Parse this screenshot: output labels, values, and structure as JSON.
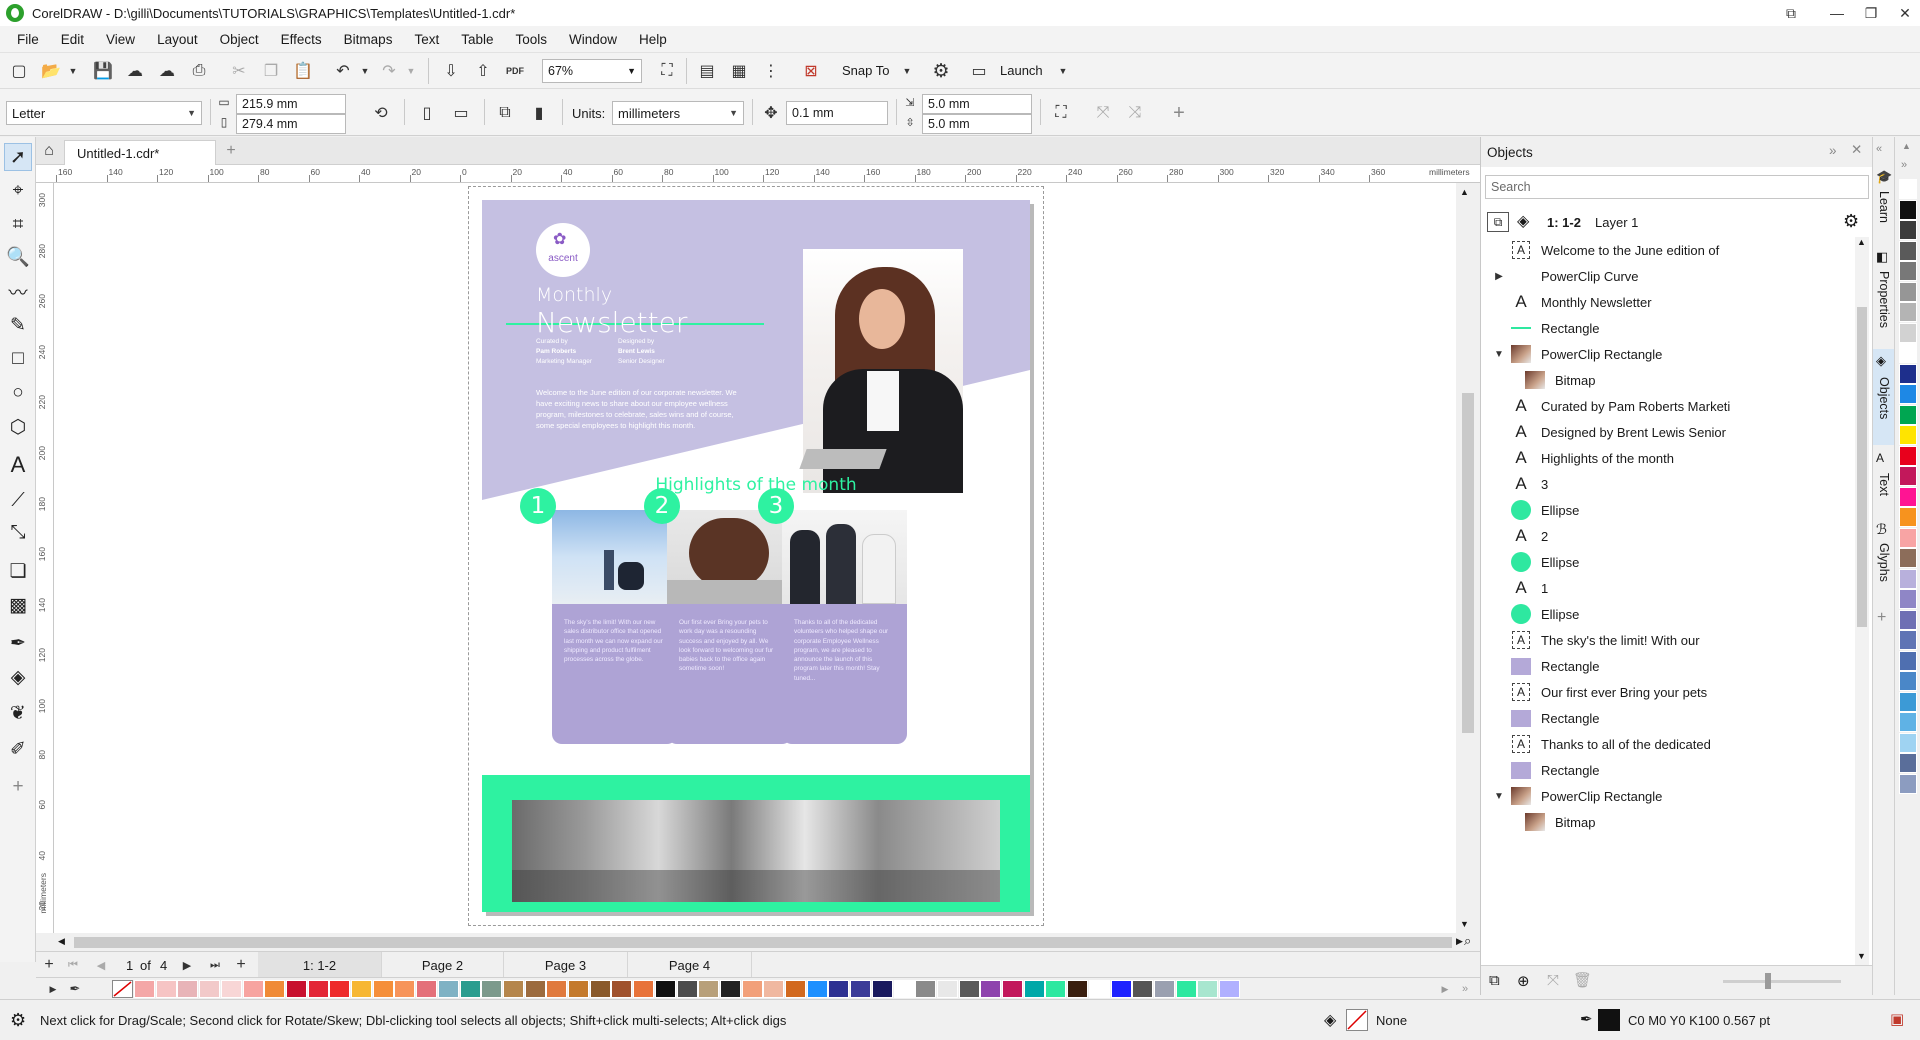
{
  "window": {
    "title": "CorelDRAW - D:\\gilli\\Documents\\TUTORIALS\\GRAPHICS\\Templates\\Untitled-1.cdr*"
  },
  "menu": [
    "File",
    "Edit",
    "View",
    "Layout",
    "Object",
    "Effects",
    "Bitmaps",
    "Text",
    "Table",
    "Tools",
    "Window",
    "Help"
  ],
  "standard_toolbar": {
    "zoom": "67%",
    "snap_to": "Snap To",
    "launch": "Launch",
    "pdf_label": "PDF"
  },
  "property_bar": {
    "page_size": "Letter",
    "width": "215.9 mm",
    "height": "279.4 mm",
    "units_label": "Units:",
    "units": "millimeters",
    "nudge": "0.1 mm",
    "dup_x": "5.0 mm",
    "dup_y": "5.0 mm"
  },
  "doc_tab": "Untitled-1.cdr*",
  "rulers": {
    "unit": "millimeters",
    "h_ticks": [
      "160",
      "140",
      "120",
      "100",
      "80",
      "60",
      "40",
      "20",
      "0",
      "20",
      "40",
      "60",
      "80",
      "100",
      "120",
      "140",
      "160",
      "180",
      "200",
      "220",
      "240",
      "260",
      "280",
      "300",
      "320",
      "340",
      "360"
    ],
    "v_ticks": [
      "300",
      "280",
      "260",
      "240",
      "220",
      "200",
      "180",
      "160",
      "140",
      "120",
      "100",
      "80",
      "60",
      "40",
      "20"
    ]
  },
  "newsletter": {
    "logo": "ascent",
    "monthly": "Monthly",
    "newsletter": "Newsletter",
    "curated_by_label": "Curated by",
    "curated_name": "Pam Roberts",
    "curated_role": "Marketing Manager",
    "designed_by_label": "Designed by",
    "designed_name": "Brent Lewis",
    "designed_role": "Senior Designer",
    "intro": "Welcome to the June edition of our corporate newsletter. We have exciting news to share about our employee wellness program, milestones to celebrate, sales wins and of course, some special employees to highlight this month.",
    "highlights": "Highlights of the month",
    "cards": [
      {
        "num": "1",
        "text": "The sky's the limit! With our new sales distributor office that opened last month we can now expand our shipping and product fulfilment processes across the globe."
      },
      {
        "num": "2",
        "text": "Our first ever Bring your pets to work day was a resounding success and enjoyed by all. We look forward to welcoming our fur babies back to the office again sometime soon!"
      },
      {
        "num": "3",
        "text": "Thanks to all of the dedicated volunteers who helped shape our corporate Employee Wellness program, we are pleased to announce the launch of this program later this month! Stay tuned..."
      }
    ]
  },
  "page_nav": {
    "current": "1",
    "of_label": "of",
    "total": "4",
    "tabs": [
      "1: 1-2",
      "Page 2",
      "Page 3",
      "Page 4"
    ]
  },
  "docker": {
    "title": "Objects",
    "search_placeholder": "Search",
    "page_label": "1: 1-2",
    "layer_label": "Layer 1",
    "items": [
      {
        "expander": "",
        "icon": "para",
        "label": "Welcome to the June edition of"
      },
      {
        "expander": "▶",
        "icon": "none",
        "label": "PowerClip Curve"
      },
      {
        "expander": "",
        "icon": "text",
        "label": "Monthly Newsletter"
      },
      {
        "expander": "",
        "icon": "line",
        "label": "Rectangle"
      },
      {
        "expander": "▼",
        "icon": "photo",
        "label": "PowerClip Rectangle"
      },
      {
        "expander": "",
        "icon": "photo",
        "label": "Bitmap",
        "indent": true
      },
      {
        "expander": "",
        "icon": "text",
        "label": "Curated by Pam Roberts Marketi"
      },
      {
        "expander": "",
        "icon": "text",
        "label": "Designed by Brent Lewis Senior"
      },
      {
        "expander": "",
        "icon": "text",
        "label": "Highlights of the month"
      },
      {
        "expander": "",
        "icon": "text",
        "label": "3"
      },
      {
        "expander": "",
        "icon": "ellipse",
        "label": "Ellipse"
      },
      {
        "expander": "",
        "icon": "text",
        "label": "2"
      },
      {
        "expander": "",
        "icon": "ellipse",
        "label": "Ellipse"
      },
      {
        "expander": "",
        "icon": "text",
        "label": "1"
      },
      {
        "expander": "",
        "icon": "ellipse",
        "label": "Ellipse"
      },
      {
        "expander": "",
        "icon": "para",
        "label": "The sky's the limit! With our"
      },
      {
        "expander": "",
        "icon": "rect",
        "label": "Rectangle"
      },
      {
        "expander": "",
        "icon": "para",
        "label": "Our first ever Bring your pets"
      },
      {
        "expander": "",
        "icon": "rect",
        "label": "Rectangle"
      },
      {
        "expander": "",
        "icon": "para",
        "label": "Thanks to all of the dedicated"
      },
      {
        "expander": "",
        "icon": "rect",
        "label": "Rectangle"
      },
      {
        "expander": "▼",
        "icon": "photo",
        "label": "PowerClip Rectangle"
      },
      {
        "expander": "",
        "icon": "photo",
        "label": "Bitmap",
        "indent": true
      }
    ]
  },
  "side_tabs": [
    "Learn",
    "Properties",
    "Objects",
    "Text",
    "Glyphs"
  ],
  "status": {
    "hint": "Next click for Drag/Scale; Second click for Rotate/Skew; Dbl-clicking tool selects all objects; Shift+click multi-selects; Alt+click digs",
    "fill": "None",
    "outline": "C0 M0 Y0 K100  0.567 pt"
  },
  "colors": {
    "accent_green": "#2ef2a1",
    "lavender": "#c5c0e2",
    "card_purple": "#aea3d5"
  },
  "palette_bottom": [
    "#f4a7a7",
    "#f6c4c4",
    "#e8b4b8",
    "#f2c9c9",
    "#f8d6d6",
    "#f7a4a0",
    "#f08a36",
    "#c8102e",
    "#e32636",
    "#ee2a2a",
    "#f7b733",
    "#f58f3a",
    "#f7945a",
    "#e4707a",
    "#7fb2c4",
    "#2a9d8f",
    "#7c9a8c",
    "#b5864c",
    "#9c6b3e",
    "#e07a3e",
    "#c47a2c",
    "#8a5a2b",
    "#a0522d",
    "#e8733a",
    "#111111",
    "#4d4d4d",
    "#b8a07a",
    "#222222",
    "#f2a07a",
    "#f0b8a0",
    "#d2691e",
    "#1e90ff",
    "#2e3192",
    "#3b3b98",
    "#1a1a5e",
    "#ffffff",
    "#8a8a8a",
    "#e8e8e8",
    "#5a5a5a",
    "#8e44ad",
    "#c2185b",
    "#00a8a8",
    "#2ee8a0",
    "#3a1f0f",
    "#ffffff",
    "#1e22ff",
    "#555555",
    "#9aa0b0",
    "#2ee8a0",
    "#a8e6cf",
    "#b0b0ff"
  ],
  "palette_right": [
    "#ffffff",
    "#111111",
    "#3c3c3c",
    "#5a5a5a",
    "#787878",
    "#969696",
    "#b4b4b4",
    "#d2d2d2",
    "#ffffff",
    "#1e2f8c",
    "#1e88e5",
    "#00a651",
    "#ffe400",
    "#e8001c",
    "#c2185b",
    "#ff1493",
    "#f7931e",
    "#f8a4a4",
    "#8c6d5a",
    "#b8b0dc",
    "#8f86c6",
    "#6e6fb4",
    "#5f74b5",
    "#4f6fb0",
    "#4a87c8",
    "#3c9ad6",
    "#5fb2e5",
    "#9fd3f2",
    "#5a6e9a",
    "#8c9cc0"
  ]
}
